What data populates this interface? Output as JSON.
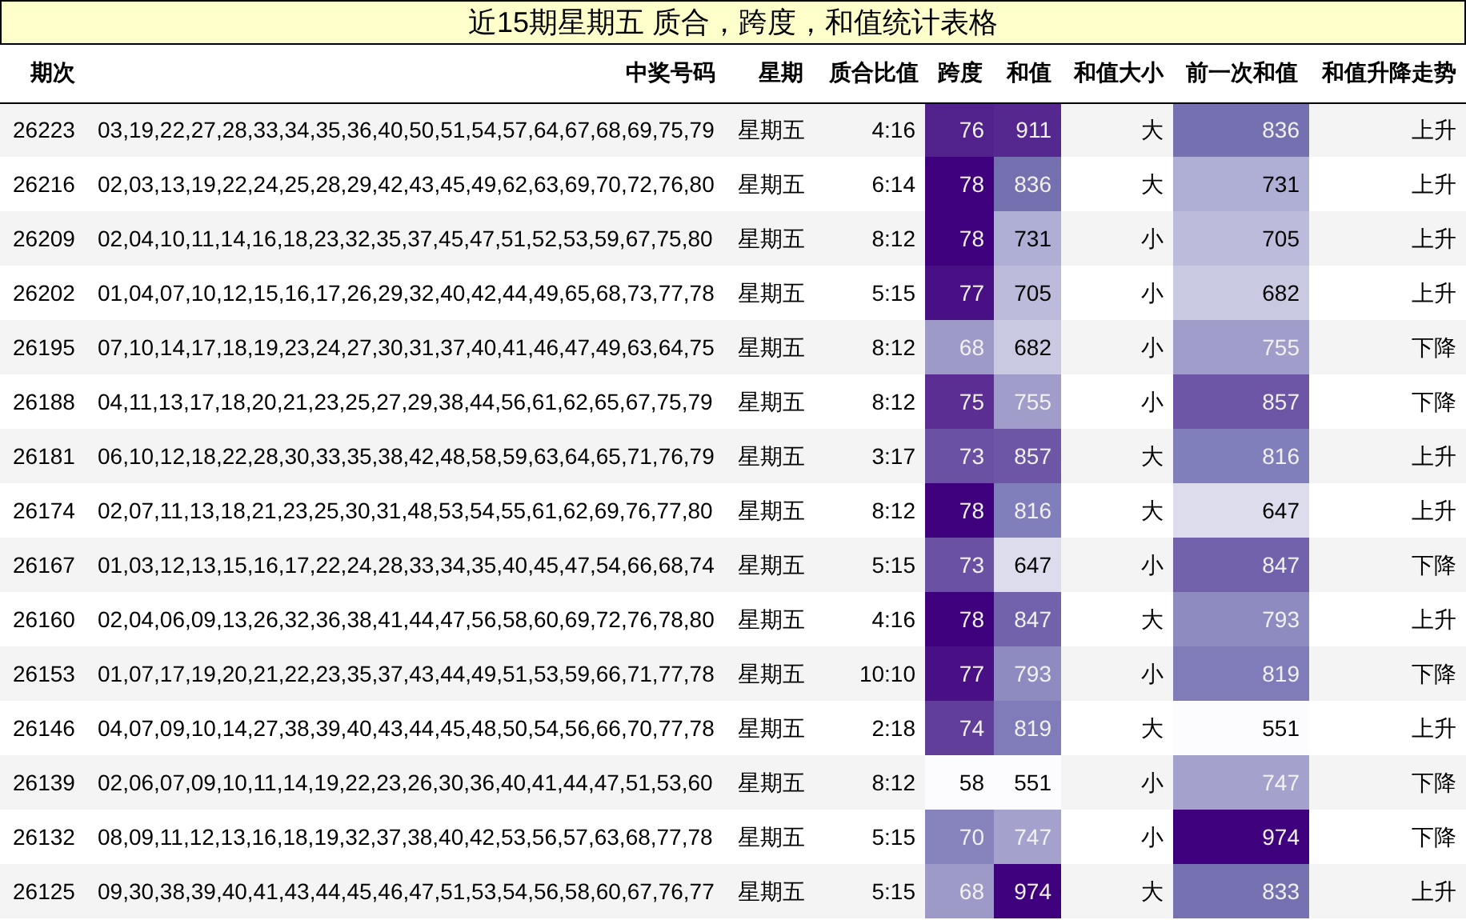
{
  "title": "近15期星期五 质合，跨度，和值统计表格",
  "columns": [
    "期次",
    "中奖号码",
    "星期",
    "质合比值",
    "跨度",
    "和值",
    "和值大小",
    "前一次和值",
    "和值升降走势"
  ],
  "rows": [
    {
      "issue": "26223",
      "numbers": "03,19,22,27,28,33,34,35,36,40,50,51,54,57,64,67,68,69,75,79",
      "weekday": "星期五",
      "ratio": "4:16",
      "span": {
        "value": "76",
        "color": "#51218c"
      },
      "sum": {
        "value": "911",
        "color": "#55288f"
      },
      "size": "大",
      "prev_sum": {
        "value": "836",
        "color": "#7570b0"
      },
      "trend": "上升"
    },
    {
      "issue": "26216",
      "numbers": "02,03,13,19,22,24,25,28,29,42,43,45,49,62,63,69,70,72,76,80",
      "weekday": "星期五",
      "ratio": "6:14",
      "span": {
        "value": "78",
        "color": "#3f007d"
      },
      "sum": {
        "value": "836",
        "color": "#7570b0"
      },
      "size": "大",
      "prev_sum": {
        "value": "731",
        "color": "#afaed4"
      },
      "trend": "上升"
    },
    {
      "issue": "26209",
      "numbers": "02,04,10,11,14,16,18,23,32,35,37,45,47,51,52,53,59,67,75,80",
      "weekday": "星期五",
      "ratio": "8:12",
      "span": {
        "value": "78",
        "color": "#3f007d"
      },
      "sum": {
        "value": "731",
        "color": "#afaed4"
      },
      "size": "小",
      "prev_sum": {
        "value": "705",
        "color": "#bcbbdb"
      },
      "trend": "上升"
    },
    {
      "issue": "26202",
      "numbers": "01,04,07,10,12,15,16,17,26,29,32,40,42,44,49,65,68,73,77,78",
      "weekday": "星期五",
      "ratio": "5:15",
      "span": {
        "value": "77",
        "color": "#490f85"
      },
      "sum": {
        "value": "705",
        "color": "#bcbbdb"
      },
      "size": "小",
      "prev_sum": {
        "value": "682",
        "color": "#cac9e2"
      },
      "trend": "上升"
    },
    {
      "issue": "26195",
      "numbers": "07,10,14,17,18,19,23,24,27,30,31,37,40,41,46,47,49,63,64,75",
      "weekday": "星期五",
      "ratio": "8:12",
      "span": {
        "value": "68",
        "color": "#9e9ac8"
      },
      "sum": {
        "value": "682",
        "color": "#cac9e2"
      },
      "size": "小",
      "prev_sum": {
        "value": "755",
        "color": "#a09dca"
      },
      "trend": "下降"
    },
    {
      "issue": "26188",
      "numbers": "04,11,13,17,18,20,21,23,25,27,29,38,44,56,61,62,65,67,75,79",
      "weekday": "星期五",
      "ratio": "8:12",
      "span": {
        "value": "75",
        "color": "#5a2e93"
      },
      "sum": {
        "value": "755",
        "color": "#a09dca"
      },
      "size": "小",
      "prev_sum": {
        "value": "857",
        "color": "#6c56a5"
      },
      "trend": "下降"
    },
    {
      "issue": "26181",
      "numbers": "06,10,12,18,22,28,30,33,35,38,42,48,58,59,63,64,65,71,76,79",
      "weekday": "星期五",
      "ratio": "3:17",
      "span": {
        "value": "73",
        "color": "#6a51a3"
      },
      "sum": {
        "value": "857",
        "color": "#6c56a5"
      },
      "size": "大",
      "prev_sum": {
        "value": "816",
        "color": "#817fbb"
      },
      "trend": "上升"
    },
    {
      "issue": "26174",
      "numbers": "02,07,11,13,18,21,23,25,30,31,48,53,54,55,61,62,69,76,77,80",
      "weekday": "星期五",
      "ratio": "8:12",
      "span": {
        "value": "78",
        "color": "#3f007d"
      },
      "sum": {
        "value": "816",
        "color": "#817fbb"
      },
      "size": "大",
      "prev_sum": {
        "value": "647",
        "color": "#dddcec"
      },
      "trend": "上升"
    },
    {
      "issue": "26167",
      "numbers": "01,03,12,13,15,16,17,22,24,28,33,34,35,40,45,47,54,66,68,74",
      "weekday": "星期五",
      "ratio": "5:15",
      "span": {
        "value": "73",
        "color": "#6a51a3"
      },
      "sum": {
        "value": "647",
        "color": "#dddcec"
      },
      "size": "小",
      "prev_sum": {
        "value": "847",
        "color": "#7262ab"
      },
      "trend": "下降"
    },
    {
      "issue": "26160",
      "numbers": "02,04,06,09,13,26,32,36,38,41,44,47,56,58,60,69,72,76,78,80",
      "weekday": "星期五",
      "ratio": "4:16",
      "span": {
        "value": "78",
        "color": "#3f007d"
      },
      "sum": {
        "value": "847",
        "color": "#7262ab"
      },
      "size": "大",
      "prev_sum": {
        "value": "793",
        "color": "#8e8bc1"
      },
      "trend": "上升"
    },
    {
      "issue": "26153",
      "numbers": "01,07,17,19,20,21,22,23,35,37,43,44,49,51,53,59,66,71,77,78",
      "weekday": "星期五",
      "ratio": "10:10",
      "span": {
        "value": "77",
        "color": "#490f85"
      },
      "sum": {
        "value": "793",
        "color": "#8e8bc1"
      },
      "size": "小",
      "prev_sum": {
        "value": "819",
        "color": "#807cba"
      },
      "trend": "下降"
    },
    {
      "issue": "26146",
      "numbers": "04,07,09,10,14,27,38,39,40,43,44,45,48,50,54,56,66,70,77,78",
      "weekday": "星期五",
      "ratio": "2:18",
      "span": {
        "value": "74",
        "color": "#623e9b"
      },
      "sum": {
        "value": "819",
        "color": "#807cba"
      },
      "size": "大",
      "prev_sum": {
        "value": "551",
        "color": "#fcfbfd"
      },
      "trend": "上升"
    },
    {
      "issue": "26139",
      "numbers": "02,06,07,09,10,11,14,19,22,23,26,30,36,40,41,44,47,51,53,60",
      "weekday": "星期五",
      "ratio": "8:12",
      "span": {
        "value": "58",
        "color": "#fcfbfd"
      },
      "sum": {
        "value": "551",
        "color": "#fcfbfd"
      },
      "size": "小",
      "prev_sum": {
        "value": "747",
        "color": "#a4a2cd"
      },
      "trend": "下降"
    },
    {
      "issue": "26132",
      "numbers": "08,09,11,12,13,16,18,19,32,37,38,40,42,53,56,57,63,68,77,78",
      "weekday": "星期五",
      "ratio": "5:15",
      "span": {
        "value": "70",
        "color": "#8683bd"
      },
      "sum": {
        "value": "747",
        "color": "#a4a2cd"
      },
      "size": "小",
      "prev_sum": {
        "value": "974",
        "color": "#3f007d"
      },
      "trend": "下降"
    },
    {
      "issue": "26125",
      "numbers": "09,30,38,39,40,41,43,44,45,46,47,51,53,54,56,58,60,67,76,77",
      "weekday": "星期五",
      "ratio": "5:15",
      "span": {
        "value": "68",
        "color": "#9e9ac8"
      },
      "sum": {
        "value": "974",
        "color": "#3f007d"
      },
      "size": "大",
      "prev_sum": {
        "value": "833",
        "color": "#7672b2"
      },
      "trend": "上升"
    }
  ]
}
